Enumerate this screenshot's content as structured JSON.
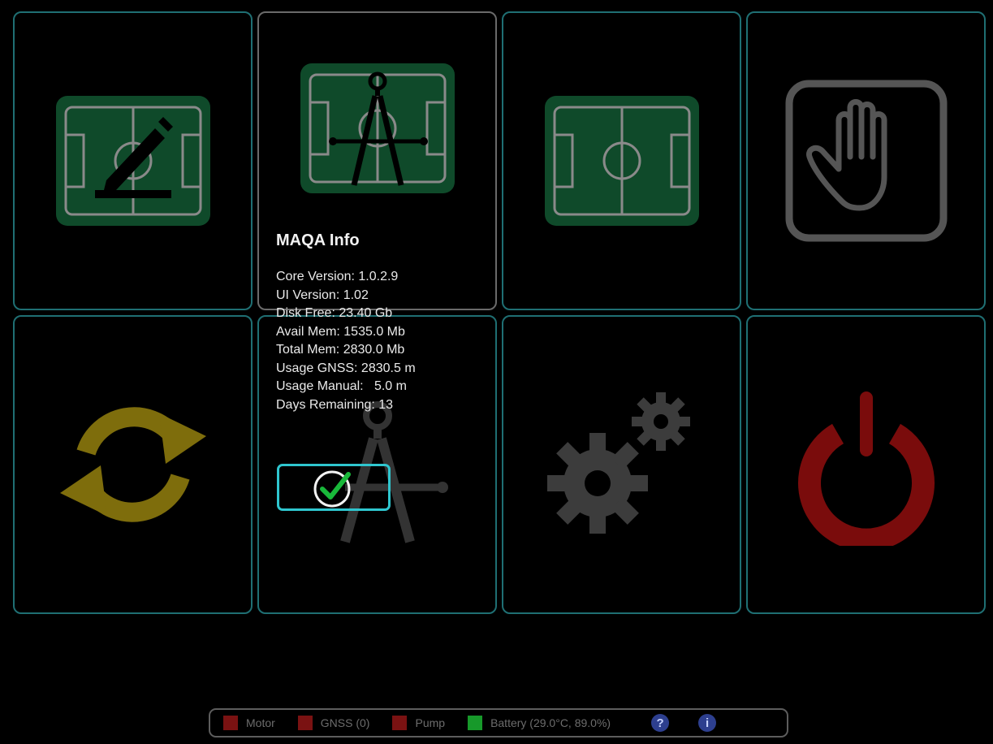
{
  "tiles": [
    {
      "name": "edit-field",
      "icon": "field-pencil-icon"
    },
    {
      "name": "field-measure",
      "icon": "field-compass-icon"
    },
    {
      "name": "field-view",
      "icon": "field-icon"
    },
    {
      "name": "manual-mode",
      "icon": "hand-icon"
    },
    {
      "name": "sync",
      "icon": "sync-icon"
    },
    {
      "name": "calibrate",
      "icon": "compass-icon"
    },
    {
      "name": "settings",
      "icon": "gears-icon"
    },
    {
      "name": "power",
      "icon": "power-icon"
    }
  ],
  "info": {
    "title": "MAQA Info",
    "lines": [
      "Core Version: 1.0.2.9",
      "UI Version: 1.02",
      "Disk Free: 23.40 Gb",
      "Avail Mem: 1535.0 Mb",
      "Total Mem: 2830.0 Mb",
      "Usage GNSS: 2830.5 m",
      "Usage Manual:   5.0 m",
      "Days Remaining: 13"
    ],
    "ok_icon": "check-circle-icon"
  },
  "status": {
    "items": [
      {
        "label": "Motor",
        "color": "#7a1212"
      },
      {
        "label": "GNSS (0)",
        "color": "#7a1212"
      },
      {
        "label": "Pump",
        "color": "#7a1212"
      },
      {
        "label": "Battery (29.0°C, 89.0%)",
        "color": "#17992a"
      }
    ],
    "help_icon": "help-icon",
    "info_icon": "info-icon"
  },
  "colors": {
    "tile_border": "#1f6f73",
    "field_green": "#0f4a2a",
    "sync_yellow": "#7e6d0c",
    "power_red": "#7a0c0c",
    "accent_cyan": "#2fc6cf"
  }
}
